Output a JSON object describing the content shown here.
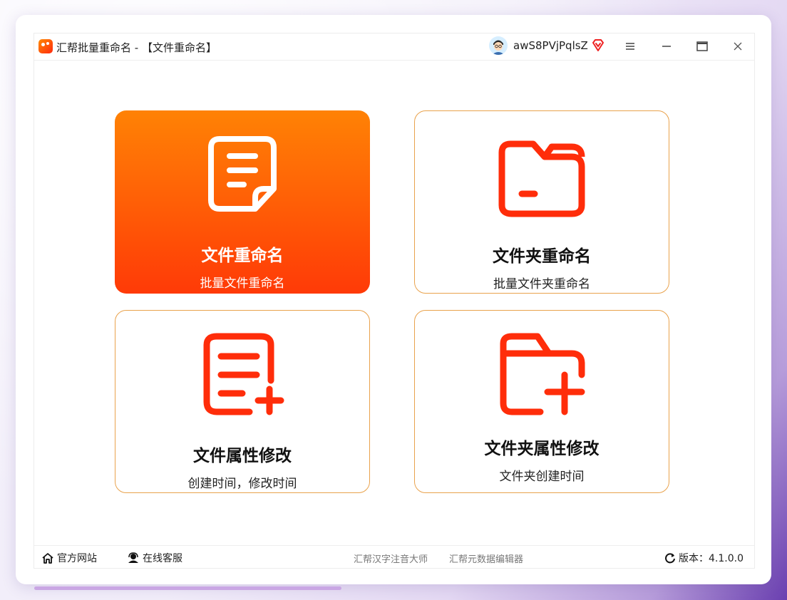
{
  "window": {
    "title": "汇帮批量重命名 - 【文件重命名】",
    "username": "awS8PVjPqlsZ"
  },
  "cards": [
    {
      "title": "文件重命名",
      "subtitle": "批量文件重命名",
      "icon": "document-icon",
      "active": true
    },
    {
      "title": "文件夹重命名",
      "subtitle": "批量文件夹重命名",
      "icon": "folder-icon",
      "active": false
    },
    {
      "title": "文件属性修改",
      "subtitle": "创建时间，修改时间",
      "icon": "document-add-icon",
      "active": false
    },
    {
      "title": "文件夹属性修改",
      "subtitle": "文件夹创建时间",
      "icon": "folder-add-icon",
      "active": false
    }
  ],
  "footer": {
    "official_site": "官方网站",
    "online_service": "在线客服",
    "link1": "汇帮汉字注音大师",
    "link2": "汇帮元数据编辑器",
    "version": "版本：4.1.0.0"
  },
  "colors": {
    "accent_start": "#ff8205",
    "accent_end": "#ff3a07",
    "icon_red": "#ff2d0a",
    "card_border": "#e9a24c"
  }
}
